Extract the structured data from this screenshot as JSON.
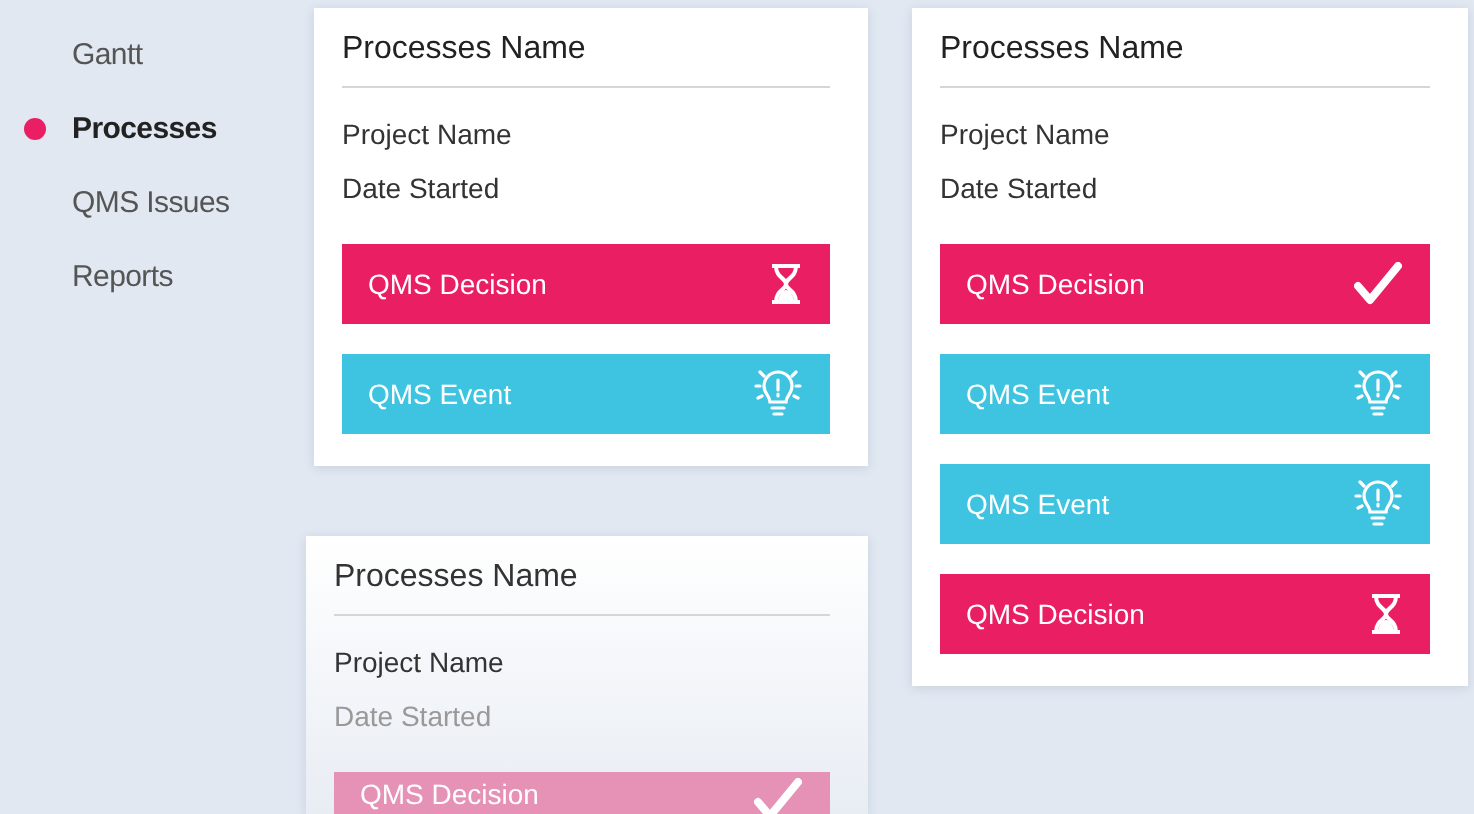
{
  "sidebar": {
    "items": [
      {
        "label": "Gantt",
        "selected": false
      },
      {
        "label": "Processes",
        "selected": true
      },
      {
        "label": "QMS Issues",
        "selected": false
      },
      {
        "label": "Reports",
        "selected": false
      }
    ]
  },
  "cards": [
    {
      "title": "Processes Name",
      "project": "Project Name",
      "date": "Date Started",
      "faded": false,
      "items": [
        {
          "kind": "decision",
          "label": "QMS Decision",
          "done": false
        },
        {
          "kind": "event",
          "label": "QMS Event"
        }
      ]
    },
    {
      "title": "Processes Name",
      "project": "Project Name",
      "date": "Date Started",
      "faded": false,
      "items": [
        {
          "kind": "decision",
          "label": "QMS Decision",
          "done": true
        },
        {
          "kind": "event",
          "label": "QMS Event"
        },
        {
          "kind": "event",
          "label": "QMS Event"
        },
        {
          "kind": "decision",
          "label": "QMS Decision",
          "done": false
        }
      ]
    },
    {
      "title": "Processes Name",
      "project": "Project Name",
      "date": "Date Started",
      "faded": true,
      "items": [
        {
          "kind": "decision",
          "label": "QMS Decision",
          "done": true
        }
      ]
    }
  ]
}
